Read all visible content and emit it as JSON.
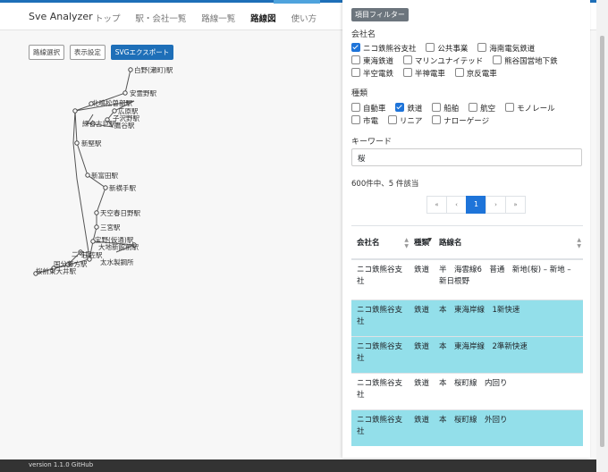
{
  "navbar": {
    "brand": "Sve Analyzer",
    "items": [
      {
        "label": "トップ"
      },
      {
        "label": "駅・会社一覧"
      },
      {
        "label": "路線一覧"
      },
      {
        "label": "路線図"
      },
      {
        "label": "使い方"
      }
    ]
  },
  "toolbar": {
    "select_label": "路線選択",
    "display_label": "表示設定",
    "export_label": "SVGエクスポート"
  },
  "map": {
    "station_labels": [
      "白野(瀬町)駅",
      "安霊野駅",
      "北鳴松曽部駅",
      "広原駅",
      "子沢野駅",
      "鷹谷駅",
      "練合古巨駅",
      "新堅駅",
      "新富田駅",
      "新横手駅",
      "天空春日野駅",
      "三宮駅",
      "宝野(仮通)駅",
      "大地新館前駅",
      "二号口",
      "日笠駅",
      "太水製鋼所",
      "国分藤方駅",
      "桜前東大井駅"
    ]
  },
  "panel": {
    "filter_button": "項目フィルター",
    "company_label": "会社名",
    "companies": [
      {
        "label": "ニコ鉄熊谷支社",
        "checked": true
      },
      {
        "label": "公共事業",
        "checked": false
      },
      {
        "label": "海南電気鉄道",
        "checked": false
      },
      {
        "label": "東海鉄道",
        "checked": false
      },
      {
        "label": "マリンユナイテッド",
        "checked": false
      },
      {
        "label": "熊谷国営地下鉄",
        "checked": false
      },
      {
        "label": "半空電鉄",
        "checked": false
      },
      {
        "label": "半神電車",
        "checked": false
      },
      {
        "label": "京反電車",
        "checked": false
      }
    ],
    "type_label": "種類",
    "types": [
      {
        "label": "自動車",
        "checked": false
      },
      {
        "label": "鉄道",
        "checked": true
      },
      {
        "label": "船舶",
        "checked": false
      },
      {
        "label": "航空",
        "checked": false
      },
      {
        "label": "モノレール",
        "checked": false
      },
      {
        "label": "市電",
        "checked": false
      },
      {
        "label": "リニア",
        "checked": false
      },
      {
        "label": "ナローゲージ",
        "checked": false
      }
    ],
    "keyword_label": "キーワード",
    "keyword_value": "桜",
    "result_count": "600件中、5 件該当",
    "pager": [
      "«",
      "‹",
      "1",
      "›",
      "»"
    ],
    "table": {
      "headers": [
        "会社名",
        "種類",
        "路線名"
      ],
      "rows": [
        {
          "company": "ニコ鉄熊谷支社",
          "type": "鉄道",
          "line": "半　海雲線6　普通　新地(桜) – 新地 – 新日根野",
          "highlight": false
        },
        {
          "company": "ニコ鉄熊谷支社",
          "type": "鉄道",
          "line": "本　東海岸線　1新快速",
          "highlight": true
        },
        {
          "company": "ニコ鉄熊谷支社",
          "type": "鉄道",
          "line": "本　東海岸線　2準新快速",
          "highlight": true
        },
        {
          "company": "ニコ鉄熊谷支社",
          "type": "鉄道",
          "line": "本　桜町線　内回り",
          "highlight": false
        },
        {
          "company": "ニコ鉄熊谷支社",
          "type": "鉄道",
          "line": "本　桜町線　外回り",
          "highlight": true
        }
      ]
    }
  },
  "footer": {
    "text": "version 1.1.0  GitHub"
  }
}
